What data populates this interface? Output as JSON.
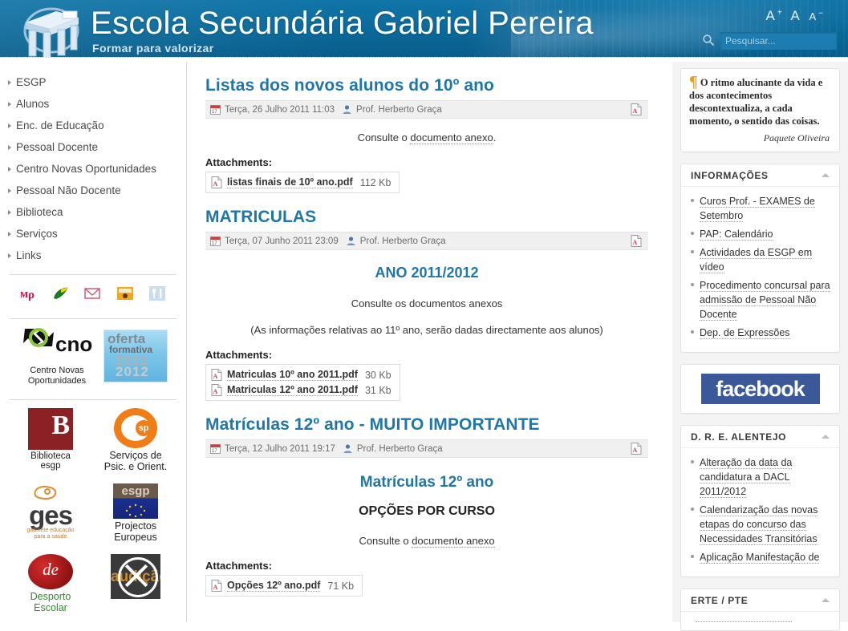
{
  "header": {
    "title": "Escola Secundária Gabriel Pereira",
    "subtitle": "Formar para valorizar",
    "logo_icon": "school-building-icon",
    "font_increase": "A",
    "font_normal": "A",
    "font_decrease": "A",
    "font_inc_sup": "+",
    "font_dec_sup": "−",
    "search_icon": "search-icon",
    "search_placeholder": "Pesquisar...",
    "search_value": "",
    "brand_color": "#0a6ca0"
  },
  "sidebar": {
    "items": [
      {
        "label": "ESGP"
      },
      {
        "label": "Alunos"
      },
      {
        "label": "Enc. de Educação"
      },
      {
        "label": "Pessoal Docente"
      },
      {
        "label": "Centro Novas Oportunidades"
      },
      {
        "label": "Pessoal Não Docente"
      },
      {
        "label": "Biblioteca"
      },
      {
        "label": "Serviços"
      },
      {
        "label": "Links"
      }
    ],
    "quick_icons": [
      {
        "name": "moodle-icon"
      },
      {
        "name": "leaf-icon"
      },
      {
        "name": "mail-icon"
      },
      {
        "name": "classroom-icon"
      },
      {
        "name": "cutlery-icon"
      }
    ],
    "banners": {
      "cno_label": "cno",
      "cno_caption_line1": "Centro Novas",
      "cno_caption_line2": "Oportunidades",
      "oferta_line1": "oferta",
      "oferta_line2": "formativa",
      "oferta_year1": "2011",
      "oferta_year2": "2012"
    },
    "logos": [
      {
        "name": "biblioteca-esgp-logo",
        "letter": "B",
        "caption_line1": "Biblioteca",
        "caption_line2": "esgp"
      },
      {
        "name": "servicos-psicologia-logo",
        "badge": "sp",
        "caption_line1": "Serviços de",
        "caption_line2": "Psic. e Orient."
      },
      {
        "name": "ges-logo",
        "text": "ges",
        "sub_line1": "gabinete educação",
        "sub_line2": "para a saúde",
        "caption_line1": "",
        "caption_line2": ""
      },
      {
        "name": "projectos-europeus-logo",
        "text": "esgp",
        "caption_line1": "Projectos",
        "caption_line2": "Europeus"
      },
      {
        "name": "desporto-escolar-logo",
        "text": "de",
        "caption_line1": "Desporto",
        "caption_line2": "Escolar"
      },
      {
        "name": "audicao-logo",
        "text": "audição",
        "caption_line1": "",
        "caption_line2": ""
      }
    ]
  },
  "articles": [
    {
      "title": "Listas dos novos alunos do 10º ano",
      "date": "Terça, 26 Julho 2011 11:03",
      "author": "Prof. Herberto Graça",
      "calendar_icon": "calendar-icon",
      "user_icon": "user-icon",
      "pdf_icon": "pdf-icon",
      "heading_blue": "",
      "heading_dark": "",
      "body_prefix": "Consulte o ",
      "body_link": "documento anexo",
      "body_suffix": ".",
      "note": "",
      "attachments_label": "Attachments:",
      "attachments": [
        {
          "name": "listas finais de 10º ano.pdf",
          "size": "112 Kb",
          "icon": "pdf-icon"
        }
      ]
    },
    {
      "title": "MATRICULAS",
      "date": "Terça, 07 Junho 2011 23:09",
      "author": "Prof. Herberto Graça",
      "calendar_icon": "calendar-icon",
      "user_icon": "user-icon",
      "pdf_icon": "pdf-icon",
      "heading_blue": "ANO 2011/2012",
      "heading_dark": "",
      "body_prefix": "Consulte os documentos anexos",
      "body_link": "",
      "body_suffix": "",
      "note": "(As informações relativas ao 11º ano, serão dadas directamente aos alunos)",
      "attachments_label": "Attachments:",
      "attachments": [
        {
          "name": "Matriculas 10º ano 2011.pdf",
          "size": "30 Kb",
          "icon": "pdf-icon"
        },
        {
          "name": "Matriculas 12º ano 2011.pdf",
          "size": "31 Kb",
          "icon": "pdf-icon"
        }
      ]
    },
    {
      "title": "Matrículas 12º ano - MUITO IMPORTANTE",
      "date": "Terça, 12 Julho 2011 19:17",
      "author": "Prof. Herberto Graça",
      "calendar_icon": "calendar-icon",
      "user_icon": "user-icon",
      "pdf_icon": "pdf-icon",
      "heading_blue": "Matrículas 12º ano",
      "heading_dark": "OPÇÕES POR CURSO",
      "body_prefix": "Consulte o ",
      "body_link": "documento anexo",
      "body_suffix": "",
      "note": "",
      "attachments_label": "Attachments:",
      "attachments": [
        {
          "name": "Opções 12º ano.pdf",
          "size": "71 Kb",
          "icon": "pdf-icon"
        }
      ]
    }
  ],
  "right": {
    "quote": {
      "mark": "¶",
      "text": "O ritmo alucinante da vida e dos acontecimentos descontextualiza, a cada momento, o sentido das coisas.",
      "author": "Paquete Oliveira",
      "mark_color": "#e6a020"
    },
    "panels": [
      {
        "title": "INFORMAÇÕES",
        "collapse_icon": "chevron-up-icon",
        "links": [
          "Curos Prof. - EXAMES de Setembro",
          "PAP: Calendário",
          "Actividades da ESGP em vídeo",
          "Procedimento concursal para admissão de Pessoal Não Docente",
          "Dep. de Expressões"
        ]
      },
      {
        "title": "D. R. E. ALENTEJO",
        "collapse_icon": "chevron-up-icon",
        "links": [
          "Alteração da data da candidatura a DACL 2011/2012",
          "Calendarização das novas etapas do concurso das Necessidades Transitórias",
          "Aplicação Manifestação de"
        ]
      },
      {
        "title": "ERTE / PTE",
        "collapse_icon": "chevron-up-icon",
        "links": []
      }
    ],
    "facebook": {
      "label": "facebook",
      "color": "#3b5998"
    }
  }
}
